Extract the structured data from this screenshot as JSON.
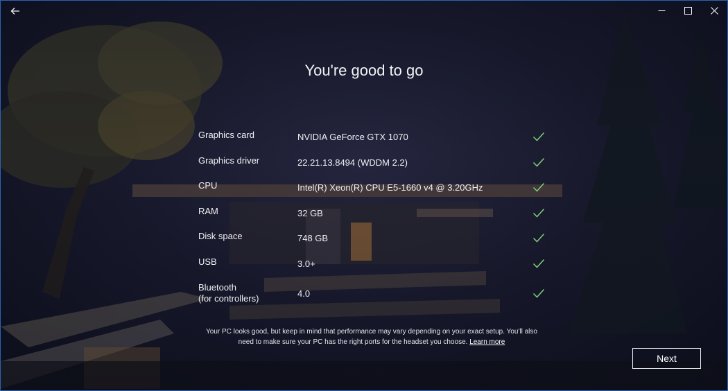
{
  "window": {
    "back_icon": "back-arrow-icon",
    "controls": [
      "minimize-icon",
      "maximize-icon",
      "close-icon"
    ]
  },
  "title": "You're good to go",
  "requirements": [
    {
      "label": "Graphics card",
      "value": "NVIDIA GeForce GTX 1070",
      "status": "pass"
    },
    {
      "label": "Graphics driver",
      "value": "22.21.13.8494 (WDDM 2.2)",
      "status": "pass"
    },
    {
      "label": "CPU",
      "value": "Intel(R) Xeon(R) CPU E5-1660 v4 @ 3.20GHz",
      "status": "pass"
    },
    {
      "label": "RAM",
      "value": "32 GB",
      "status": "pass"
    },
    {
      "label": "Disk space",
      "value": "748 GB",
      "status": "pass"
    },
    {
      "label": "USB",
      "value": "3.0+",
      "status": "pass"
    },
    {
      "label": "Bluetooth\n(for controllers)",
      "value": "4.0",
      "status": "pass"
    }
  ],
  "note": {
    "text": "Your PC looks good, but keep in mind that performance may vary depending on your exact setup. You'll also need to make sure your PC has the right ports for the headset you choose.",
    "link": "Learn more"
  },
  "next_label": "Next",
  "colors": {
    "check": "#7fd07a",
    "window_border": "#2b63b5"
  }
}
